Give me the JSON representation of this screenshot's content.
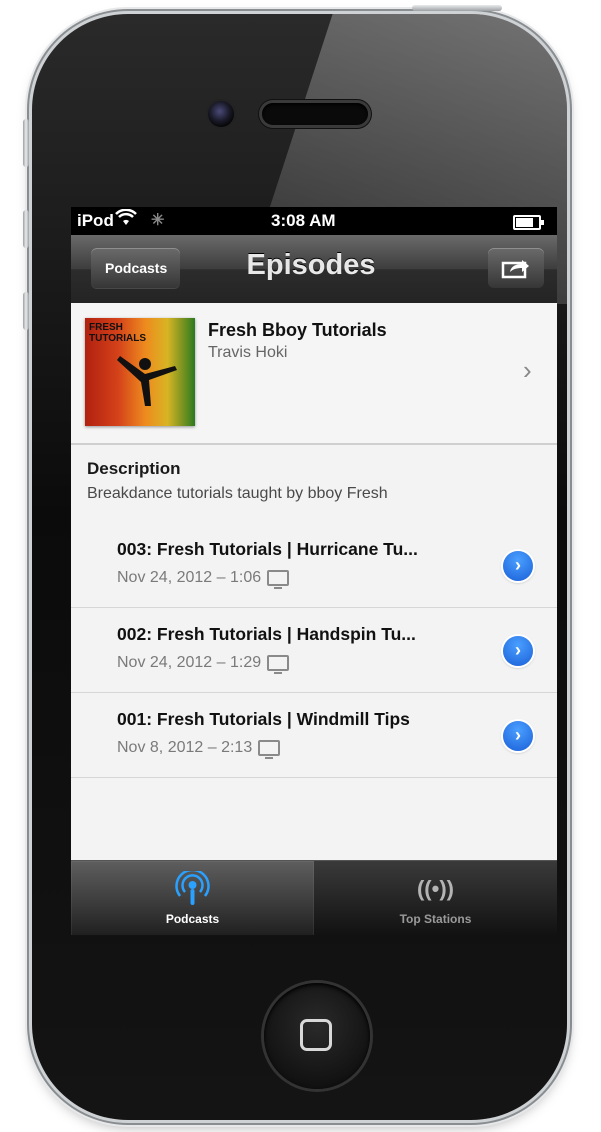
{
  "status_bar": {
    "carrier": "iPod",
    "time": "3:08 AM"
  },
  "nav": {
    "back_label": "Podcasts",
    "title": "Episodes"
  },
  "podcast": {
    "title": "Fresh Bboy Tutorials",
    "author": "Travis Hoki",
    "artwork_text": "FRESH TUTORIALS"
  },
  "description": {
    "label": "Description",
    "text": "Breakdance tutorials taught by bboy Fresh"
  },
  "episodes": [
    {
      "title": "003: Fresh Tutorials | Hurricane Tu...",
      "date": "Nov 24, 2012 – 1:06"
    },
    {
      "title": "002: Fresh Tutorials | Handspin Tu...",
      "date": "Nov 24, 2012 – 1:29"
    },
    {
      "title": "001: Fresh Tutorials | Windmill Tips",
      "date": "Nov 8, 2012 – 2:13"
    }
  ],
  "tabs": [
    {
      "label": "Podcasts",
      "icon": "podcast-icon",
      "active": true
    },
    {
      "label": "Top Stations",
      "icon": "radio-waves-icon",
      "active": false
    }
  ],
  "colors": {
    "accent_blue": "#1a8cff",
    "nav_gray": "#3d3d3d"
  }
}
